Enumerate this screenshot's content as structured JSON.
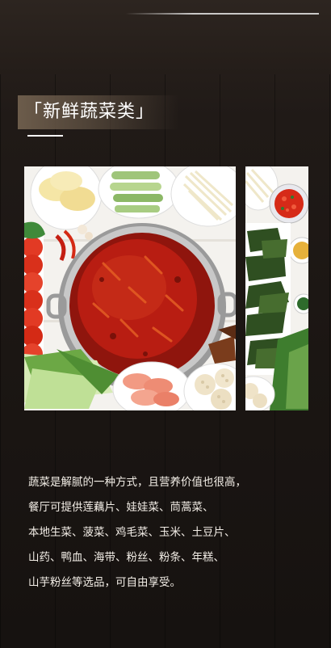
{
  "section": {
    "title": "「新鲜蔬菜类」"
  },
  "description": {
    "lines": [
      "蔬菜是解腻的一种方式，且营养价值也很高，",
      "餐厅可提供莲藕片、娃娃菜、茼蒿菜、",
      "本地生菜、菠菜、鸡毛菜、玉米、土豆片、",
      "山药、鸭血、海带、粉丝、粉条、年糕、",
      "山芋粉丝等选品，可自由享受。"
    ]
  },
  "colors": {
    "background": "#1d1815",
    "heading_band": "#6c5c4b",
    "broth": "#b81d12"
  }
}
